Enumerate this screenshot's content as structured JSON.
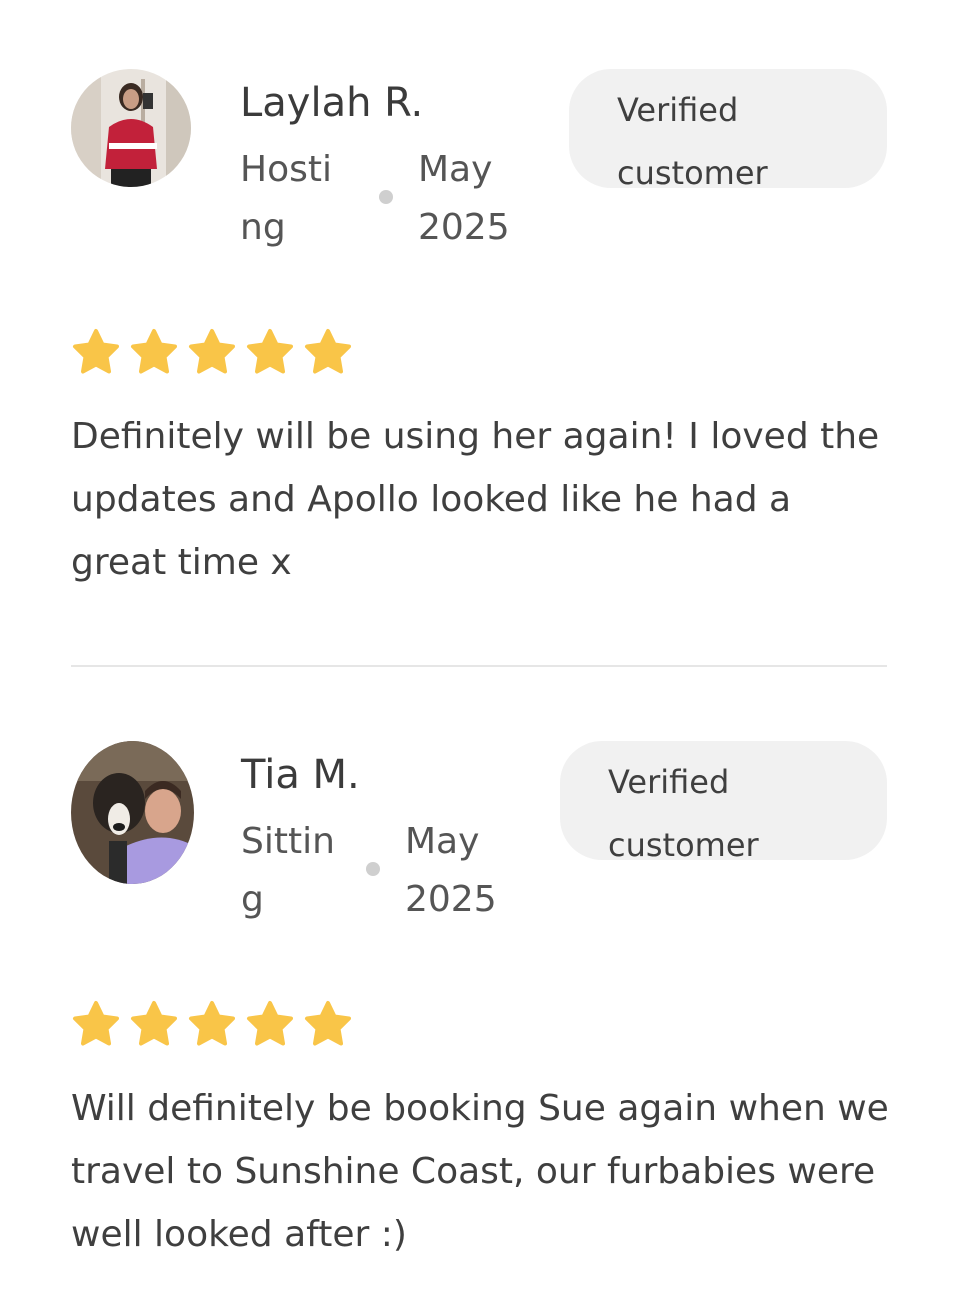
{
  "reviews": [
    {
      "name": "Laylah R.",
      "service": "Hosting",
      "date": "May 2025",
      "badge": "Verified customer",
      "rating": 5,
      "text": "Definitely will be using her again! I loved the updates and Apollo looked like he had a great time x"
    },
    {
      "name": "Tia M.",
      "service": "Sitting",
      "date": "May 2025",
      "badge": "Verified customer",
      "rating": 5,
      "text": "Will definitely be booking Sue again when we travel to Sunshine Coast, our furbabies were well looked after :)"
    }
  ],
  "colors": {
    "star": "#F9C548",
    "badge_bg": "#F1F1F1",
    "divider": "#E6E6E6"
  }
}
